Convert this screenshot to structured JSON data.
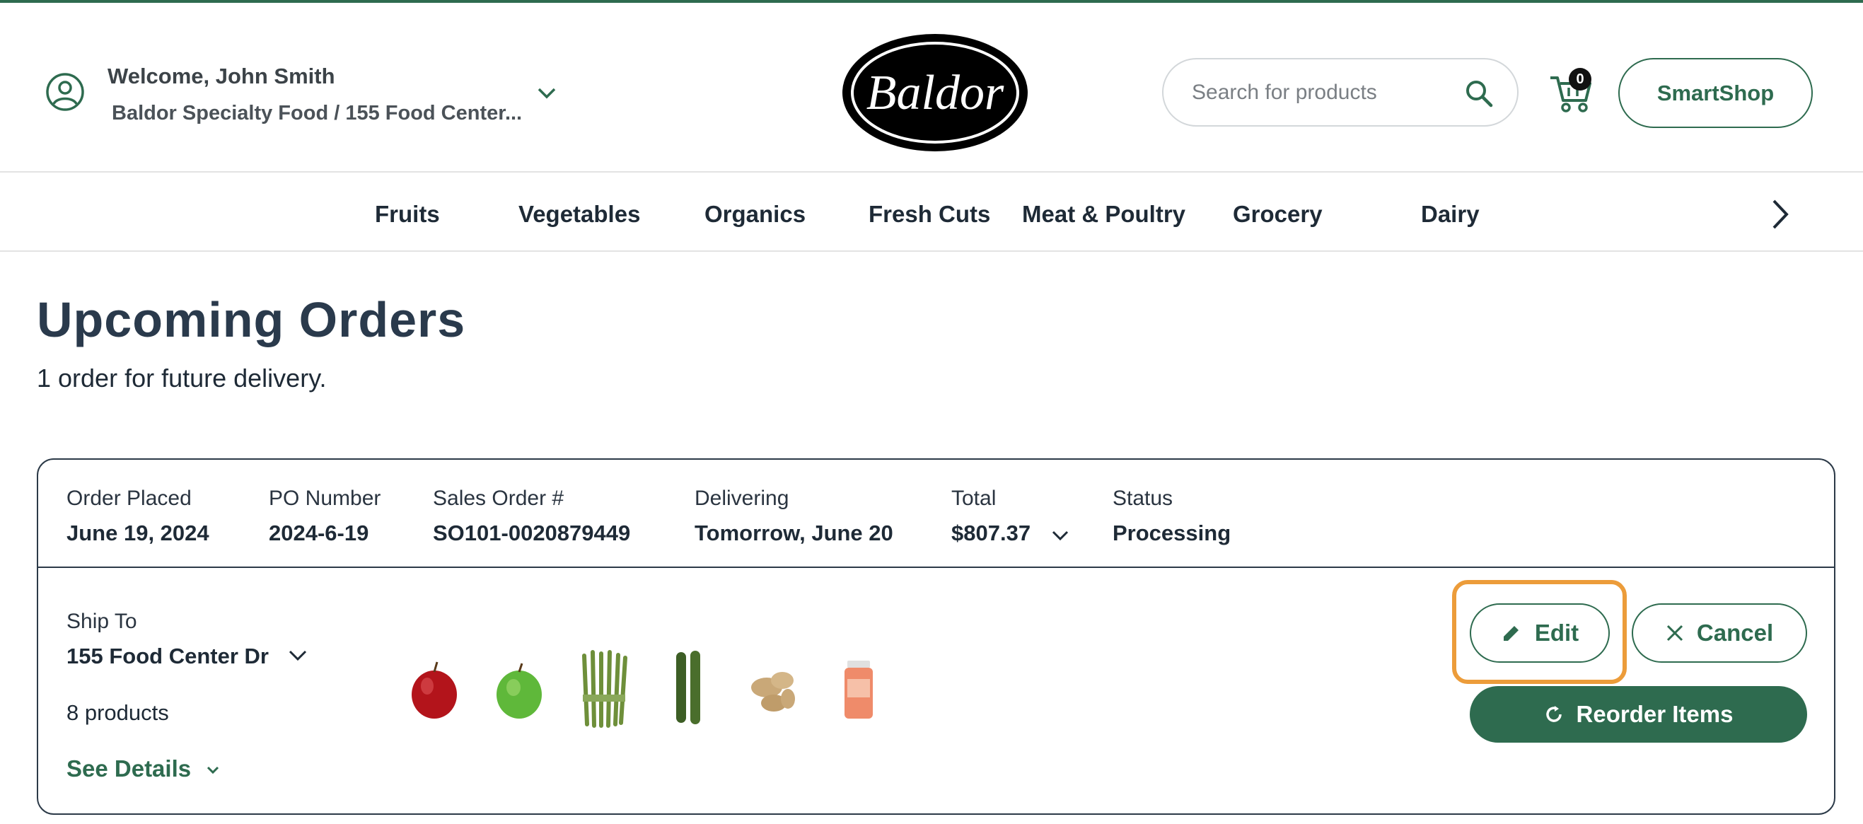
{
  "header": {
    "welcome": "Welcome, John Smith",
    "account": "Baldor Specialty Food / 155 Food Center...",
    "logo_text": "Baldor",
    "search_placeholder": "Search for products",
    "cart_count": "0",
    "smartshop_label": "SmartShop"
  },
  "nav": {
    "items": [
      "Fruits",
      "Vegetables",
      "Organics",
      "Fresh Cuts",
      "Meat & Poultry",
      "Grocery",
      "Dairy"
    ]
  },
  "page": {
    "title": "Upcoming Orders",
    "subtitle": "1 order for future delivery."
  },
  "order": {
    "order_placed_label": "Order Placed",
    "order_placed_value": "June 19, 2024",
    "po_label": "PO Number",
    "po_value": "2024-6-19",
    "sales_order_label": "Sales Order #",
    "sales_order_value": "SO101-0020879449",
    "delivering_label": "Delivering",
    "delivering_value": "Tomorrow, June 20",
    "total_label": "Total",
    "total_value": "$807.37",
    "status_label": "Status",
    "status_value": "Processing",
    "ship_to_label": "Ship To",
    "ship_to_value": "155 Food Center Dr",
    "product_count": "8 products",
    "see_details_label": "See Details",
    "products": [
      "red-apple",
      "green-apple",
      "asparagus",
      "cucumber",
      "ginger",
      "spice-jar"
    ],
    "edit_label": "Edit",
    "cancel_label": "Cancel",
    "reorder_label": "Reorder Items"
  },
  "colors": {
    "brand_green": "#2e6b4f",
    "highlight_orange": "#ec9c3a",
    "text_dark": "#1e2a36"
  }
}
